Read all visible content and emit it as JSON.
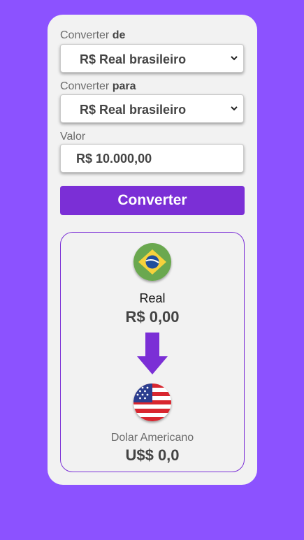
{
  "form": {
    "from": {
      "label_prefix": "Converter ",
      "label_strong": "de",
      "selected": "R$ Real brasileiro"
    },
    "to": {
      "label_prefix": "Converter ",
      "label_strong": "para",
      "selected": "R$ Real brasileiro"
    },
    "amount": {
      "label": "Valor",
      "value": "R$ 10.000,00"
    },
    "convert_button": "Converter"
  },
  "result": {
    "source": {
      "flag_icon": "brazil-flag-icon",
      "name": "Real",
      "value": "R$ 0,00"
    },
    "arrow_icon": "arrow-down-icon",
    "target": {
      "flag_icon": "usa-flag-icon",
      "name": "Dolar Americano",
      "value": "U$$ 0,0"
    }
  },
  "colors": {
    "background": "#8c52ff",
    "card": "#f2f2f2",
    "accent": "#7b2fd6"
  }
}
